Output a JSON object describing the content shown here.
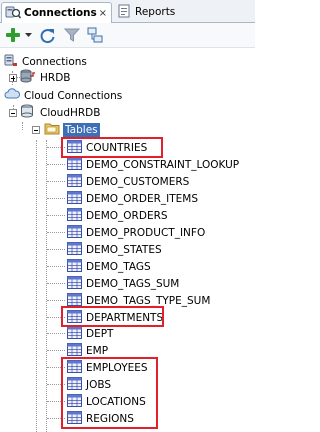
{
  "tabs": {
    "connections_label": "Connections",
    "connections_close": "×",
    "reports_label": "Reports"
  },
  "toolbar": {
    "add_icon": "add-connection-icon",
    "dropdown_icon": "dropdown-arrow-icon",
    "refresh_icon": "refresh-icon",
    "filter_icon": "filter-icon",
    "schema_icon": "schema-browser-icon"
  },
  "tree": {
    "connections_label": "Connections",
    "hrdb_label": "HRDB",
    "cloud_connections_label": "Cloud Connections",
    "cloudhrdb_label": "CloudHRDB",
    "tables_label": "Tables",
    "tables": [
      "COUNTRIES",
      "DEMO_CONSTRAINT_LOOKUP",
      "DEMO_CUSTOMERS",
      "DEMO_ORDER_ITEMS",
      "DEMO_ORDERS",
      "DEMO_PRODUCT_INFO",
      "DEMO_STATES",
      "DEMO_TAGS",
      "DEMO_TAGS_SUM",
      "DEMO_TAGS_TYPE_SUM",
      "DEPARTMENTS",
      "DEPT",
      "EMP",
      "EMPLOYEES",
      "JOBS",
      "LOCATIONS",
      "REGIONS"
    ]
  },
  "colors": {
    "highlight_box": "#e0202a",
    "selection": "#3d6fb6"
  }
}
